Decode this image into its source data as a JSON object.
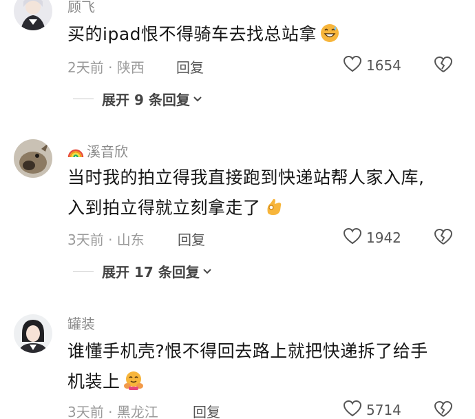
{
  "comments": [
    {
      "username": "顾飞",
      "text_lines": [
        "买的ipad恨不得骑车去找总站拿"
      ],
      "emoji": "grinning-sweat-emoji",
      "time_location": "2天前 · 陕西",
      "reply_label": "回复",
      "likes": "1654",
      "expand_label": "展开 9 条回复"
    },
    {
      "username": "溪音欣",
      "username_icon": "rainbow-icon",
      "text_lines": [
        "当时我的拍立得我直接跑到快递站帮人家入库,",
        "入到拍立得就立刻拿走了"
      ],
      "emoji": "ok-hand-emoji",
      "time_location": "3天前 · 山东",
      "reply_label": "回复",
      "likes": "1942",
      "expand_label": "展开 17 条回复"
    },
    {
      "username": "罐装",
      "text_lines": [
        "谁懂手机壳?恨不得回去路上就把快递拆了给手",
        "机装上"
      ],
      "emoji": "hugging-face-emoji",
      "time_location": "3天前 · 黑龙江",
      "reply_label": "回复",
      "likes": "5714"
    }
  ],
  "colors": {
    "text_primary": "#161616",
    "text_secondary": "#9a9a9a",
    "username": "#8a8a8a",
    "emoji_yellow": "#f7b53b"
  }
}
